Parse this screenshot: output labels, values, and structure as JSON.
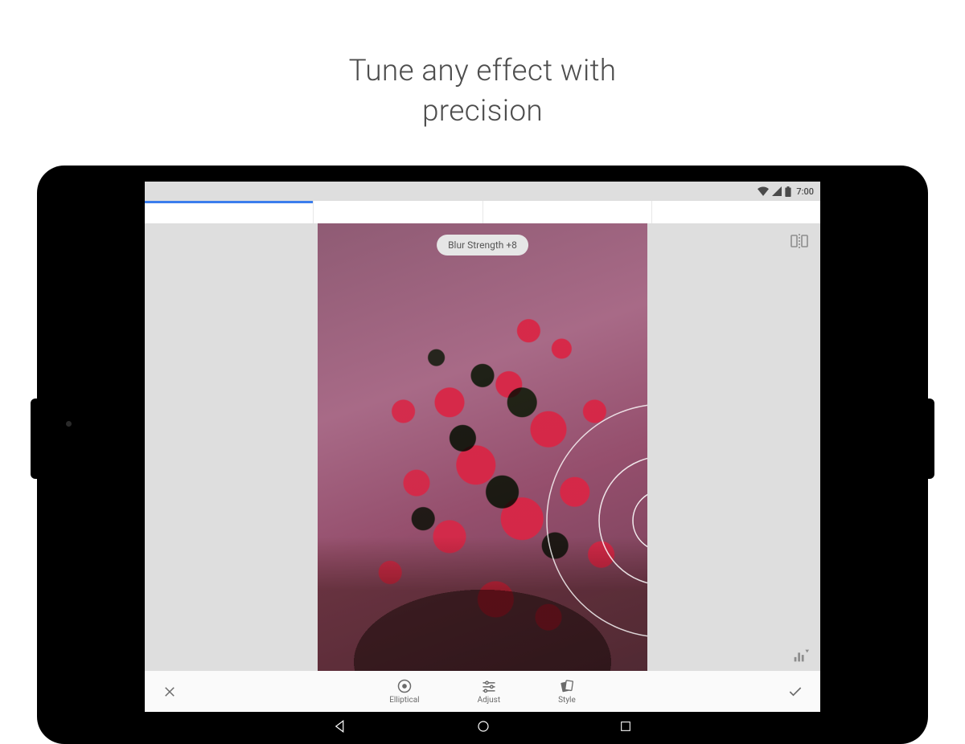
{
  "promo": {
    "headline_line1": "Tune any effect with",
    "headline_line2": "precision"
  },
  "statusbar": {
    "time": "7:00"
  },
  "editor": {
    "overlay_label": "Blur Strength +8",
    "tools": {
      "elliptical": "Elliptical",
      "adjust": "Adjust",
      "style": "Style"
    }
  }
}
